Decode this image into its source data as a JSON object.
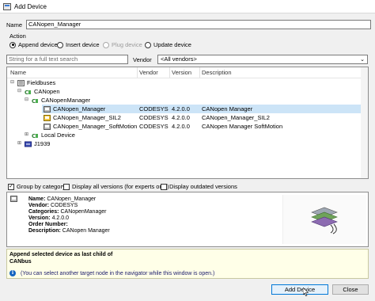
{
  "window": {
    "title": "Add Device"
  },
  "name_field": {
    "label": "Name",
    "value": "CANopen_Manager"
  },
  "action": {
    "label": "Action",
    "options": [
      {
        "label": "Append device",
        "selected": true,
        "disabled": false
      },
      {
        "label": "Insert device",
        "selected": false,
        "disabled": false
      },
      {
        "label": "Plug device",
        "selected": false,
        "disabled": true
      },
      {
        "label": "Update device",
        "selected": false,
        "disabled": false
      }
    ]
  },
  "search": {
    "placeholder": "String for a full text search"
  },
  "vendor": {
    "label": "Vendor",
    "value": "<All vendors>"
  },
  "tree": {
    "columns": [
      "Name",
      "Vendor",
      "Version",
      "Description"
    ],
    "rows": [
      {
        "toggle": "⊟",
        "icon": "fieldbus-icon",
        "name": "Fieldbuses",
        "vendor": "",
        "version": "",
        "description": ""
      },
      {
        "toggle": "⊟",
        "icon": "can-icon",
        "name": "CANopen",
        "vendor": "",
        "version": "",
        "description": ""
      },
      {
        "toggle": "⊟",
        "icon": "can-icon",
        "name": "CANopenManager",
        "vendor": "",
        "version": "",
        "description": ""
      },
      {
        "toggle": "",
        "icon": "device-icon",
        "name": "CANopen_Manager",
        "vendor": "CODESYS",
        "version": "4.2.0.0",
        "description": "CANopen Manager",
        "selected": true
      },
      {
        "toggle": "",
        "icon": "device-sil2-icon",
        "name": "CANopen_Manager_SIL2",
        "vendor": "CODESYS",
        "version": "4.2.0.0",
        "description": "CANopen_Manager_SIL2"
      },
      {
        "toggle": "",
        "icon": "device-icon",
        "name": "CANopen_Manager_SoftMotion",
        "vendor": "CODESYS",
        "version": "4.2.0.0",
        "description": "CANopen Manager SoftMotion"
      },
      {
        "toggle": "⊞",
        "icon": "can-icon",
        "name": "Local Device",
        "vendor": "",
        "version": "",
        "description": ""
      },
      {
        "toggle": "⊞",
        "icon": "j1939-icon",
        "name": "J1939",
        "vendor": "",
        "version": "",
        "description": ""
      }
    ]
  },
  "options": {
    "group_by_category": {
      "label": "Group by category",
      "checked": true
    },
    "display_all_versions": {
      "label": "Display all versions (for experts only)",
      "checked": false
    },
    "display_outdated_versions": {
      "label": "Display outdated versions",
      "checked": false
    }
  },
  "info": {
    "name_label": "Name:",
    "name": "CANopen_Manager",
    "vendor_label": "Vendor:",
    "vendor": "CODESYS",
    "categories_label": "Categories:",
    "categories": "CANopenManager",
    "version_label": "Version:",
    "version": "4.2.0.0",
    "order_label": "Order Number:",
    "order": "",
    "description_label": "Description:",
    "description": "CANopen Manager"
  },
  "message": {
    "line1": "Append selected device as last child of",
    "line2": "CANbus",
    "hint": "(You can select another target node in the navigator while this window is open.)"
  },
  "buttons": {
    "add": "Add Device",
    "close": "Close"
  },
  "colors": {
    "selection": "#cce4f7",
    "accent": "#0078d7",
    "message_bg": "#ffffe8"
  }
}
